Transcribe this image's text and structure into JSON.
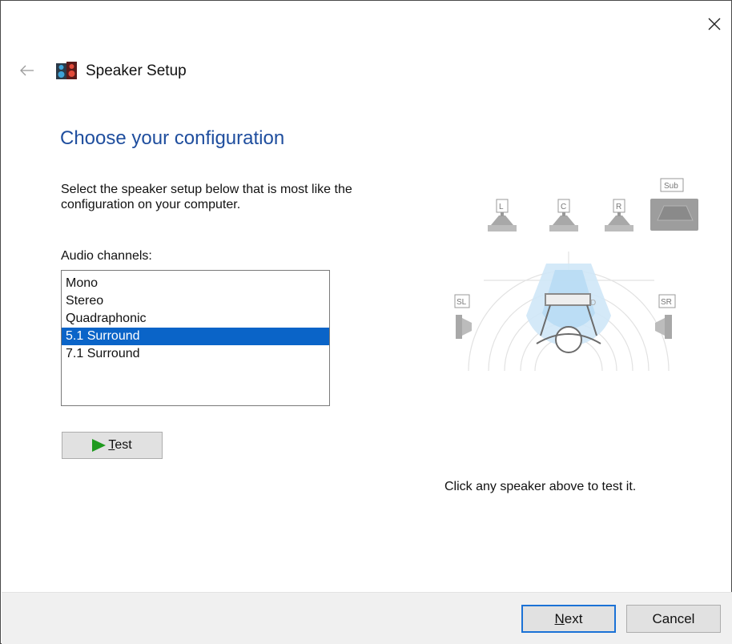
{
  "window": {
    "title": "Speaker Setup"
  },
  "page": {
    "heading": "Choose your configuration",
    "instructions": "Select the speaker setup below that is most like the configuration on your computer.",
    "channels_label": "Audio channels:",
    "channels": [
      {
        "label": "Mono",
        "selected": false
      },
      {
        "label": "Stereo",
        "selected": false
      },
      {
        "label": "Quadraphonic",
        "selected": false
      },
      {
        "label": "5.1 Surround",
        "selected": true
      },
      {
        "label": "7.1 Surround",
        "selected": false
      }
    ],
    "test_button": "Test",
    "hint": "Click any speaker above to test it."
  },
  "speakers": {
    "left": "L",
    "center": "C",
    "right": "R",
    "sub": "Sub",
    "surround_left": "SL",
    "surround_right": "SR"
  },
  "footer": {
    "next": "Next",
    "cancel": "Cancel"
  },
  "colors": {
    "heading": "#1f4e9e",
    "selection": "#0a64c8",
    "focus_border": "#1b72d6",
    "play": "#1e9a1e"
  }
}
